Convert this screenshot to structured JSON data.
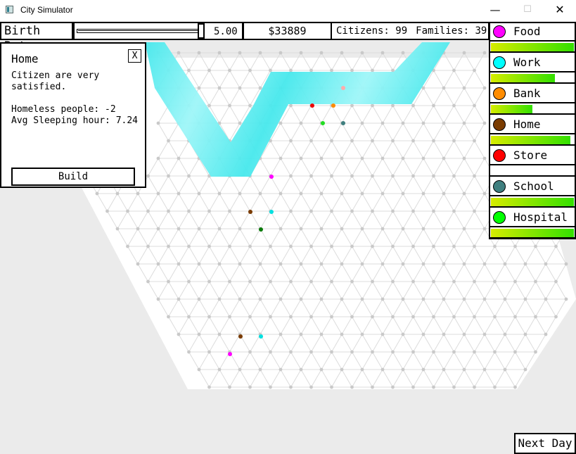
{
  "window": {
    "title": "City Simulator",
    "minimize": "—",
    "maximize": "☐",
    "close": "✕"
  },
  "toolbar": {
    "birth_rate_label": "Birth Rate",
    "birth_rate_value": "5.00",
    "birth_rate_fraction": 0.97,
    "money": "$33889",
    "citizens": "Citizens: 99",
    "families": "Families: 39"
  },
  "legend": [
    {
      "label": "Food",
      "color": "#ff00ff",
      "level": 1.0
    },
    {
      "label": "Work",
      "color": "#00ffff",
      "level": 0.77
    },
    {
      "label": "Bank",
      "color": "#ff8c00",
      "level": 0.5
    },
    {
      "label": "Home",
      "color": "#7a3b00",
      "level": 0.96
    },
    {
      "label": "Store",
      "color": "#ff0000",
      "level": 0.0
    },
    {
      "label": "School",
      "color": "#3f7f7f",
      "level": 1.0
    },
    {
      "label": "Hospital",
      "color": "#00ff00",
      "level": 1.0
    }
  ],
  "panel": {
    "title": "Home",
    "close": "X",
    "line1": "Citizen are very",
    "line2": "satisfied.",
    "homeless": "Homeless people: -2",
    "sleeping": "Avg Sleeping hour: 7.24",
    "build": "Build"
  },
  "next_day": "Next Day"
}
